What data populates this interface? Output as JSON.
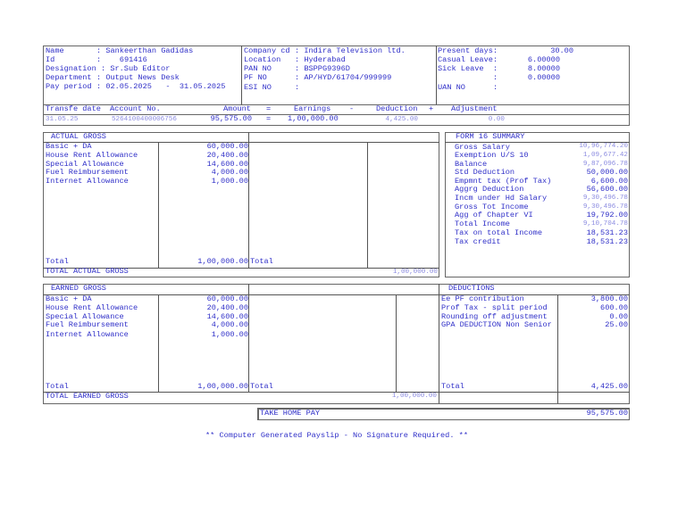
{
  "employee": {
    "name_label": "Name",
    "name": ": Sankeerthan Gadidas",
    "id_label": "Id",
    "id": ":    691416",
    "designation_label": "Designation",
    "designation": ": Sr.Sub Editor",
    "department_label": "Department",
    "department": ": Output News Desk",
    "pay_period_label": "Pay period",
    "pay_period": ": 02.05.2025   -  31.05.2025"
  },
  "company": {
    "company_label": "Company cd",
    "company": ": Indira Television ltd.",
    "location_label": "Location",
    "location": ": Hyderabad",
    "pan_label": "PAN NO",
    "pan": ": BSPPG9396D",
    "pf_label": "PF NO",
    "pf": ": AP/HYD/61704/999999",
    "esi_label": "ESI NO",
    "esi": ":"
  },
  "attendance": {
    "present_label": "Present days:",
    "present": "30.00",
    "casual_label": "Casual Leave:",
    "casual": "6.00000",
    "sick_label": "Sick Leave  :",
    "sick": "8.00000",
    "blank_label": "            :",
    "blank": "0.00000",
    "uan_label": "UAN NO",
    "uan": ":"
  },
  "transfer": {
    "headers": [
      "Transfe date",
      "Account No.",
      "Amount",
      "=",
      "Earnings",
      "-",
      "Deduction",
      "+",
      "Adjustment"
    ],
    "date": "31.05.25",
    "account": "5264100400006756",
    "amount": "95,575.00",
    "eq": "=",
    "earnings": "1,00,000.00",
    "deduction": "4,425.00",
    "adjustment": "0.00"
  },
  "actual_gross": {
    "title": "ACTUAL GROSS",
    "items": [
      {
        "label": "Basic + DA",
        "value": "60,000.00"
      },
      {
        "label": "House Rent Allowance",
        "value": "20,400.00"
      },
      {
        "label": "Special Allowance",
        "value": "14,600.00"
      },
      {
        "label": "Fuel Reimbursement",
        "value": "4,000.00"
      },
      {
        "label": "Internet Allowance",
        "value": "1,000.00"
      }
    ],
    "total_label": "Total",
    "total": "1,00,000.00",
    "total2_label": "Total",
    "grand_label": "TOTAL ACTUAL GROSS",
    "grand": "1,00,000.00"
  },
  "form16": {
    "title": "FORM 16 SUMMARY",
    "items": [
      {
        "label": "Gross Salary",
        "value": "10,96,774.20"
      },
      {
        "label": "Exemption U/S 10",
        "value": "1,09,677.42"
      },
      {
        "label": "Balance",
        "value": "9,87,096.78"
      },
      {
        "label": "Std Deduction",
        "value": "50,000.00"
      },
      {
        "label": "Empmnt tax (Prof Tax)",
        "value": "6,600.00"
      },
      {
        "label": "Aggrg Deduction",
        "value": "56,600.00"
      },
      {
        "label": "Incm under Hd Salary",
        "value": "9,30,496.78"
      },
      {
        "label": "Gross Tot Income",
        "value": "9,30,496.78"
      },
      {
        "label": "Agg of Chapter VI",
        "value": "19,792.00"
      },
      {
        "label": "Total Income",
        "value": "9,10,704.78"
      },
      {
        "label": "Tax on total Income",
        "value": "18,531.23"
      },
      {
        "label": "Tax credit",
        "value": "18,531.23"
      }
    ]
  },
  "earned_gross": {
    "title": "EARNED GROSS",
    "items": [
      {
        "label": "Basic + DA",
        "value": "60,000.00"
      },
      {
        "label": "House Rent Allowance",
        "value": "20,400.00"
      },
      {
        "label": "Special Allowance",
        "value": "14,600.00"
      },
      {
        "label": "Fuel Reimbursement",
        "value": "4,000.00"
      },
      {
        "label": "Internet Allowance",
        "value": "1,000.00"
      }
    ],
    "total_label": "Total",
    "total": "1,00,000.00",
    "total2_label": "Total",
    "grand_label": "TOTAL EARNED GROSS",
    "grand": "1,00,000.00"
  },
  "deductions": {
    "title": "DEDUCTIONS",
    "items": [
      {
        "label": "Ee PF contribution",
        "value": "3,800.00"
      },
      {
        "label": "Prof Tax - split period",
        "value": "600.00"
      },
      {
        "label": "Rounding off adjustment",
        "value": "0.00"
      },
      {
        "label": "GPA DEDUCTION Non Senior",
        "value": "25.00"
      }
    ],
    "total_label": "Total",
    "total": "4,425.00"
  },
  "take_home": {
    "label": "TAKE HOME PAY",
    "value": "95,575.00"
  },
  "footer": "** Computer Generated Payslip - No Signature Required. **"
}
